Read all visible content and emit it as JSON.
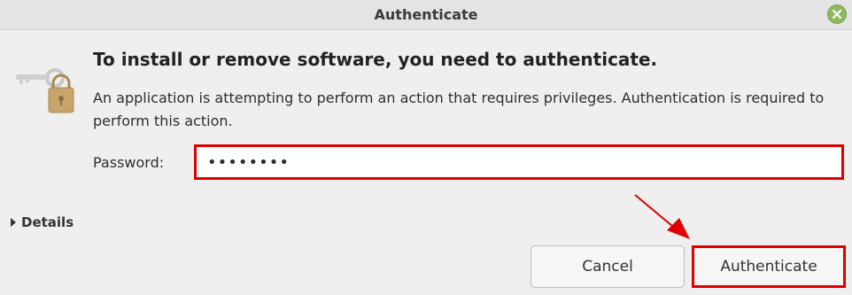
{
  "window": {
    "title": "Authenticate"
  },
  "dialog": {
    "heading": "To install or remove software, you need to authenticate.",
    "description": "An application is attempting to perform an action that requires privileges. Authentication is required to perform this action.",
    "password_label": "Password:",
    "password_value": "••••••••",
    "details_label": "Details",
    "cancel_label": "Cancel",
    "authenticate_label": "Authenticate"
  },
  "icons": {
    "auth": "key-padlock-icon",
    "close": "close-icon",
    "expander": "triangle-right-icon"
  },
  "colors": {
    "highlight": "#e00000",
    "close_button": "#8fb85f"
  }
}
